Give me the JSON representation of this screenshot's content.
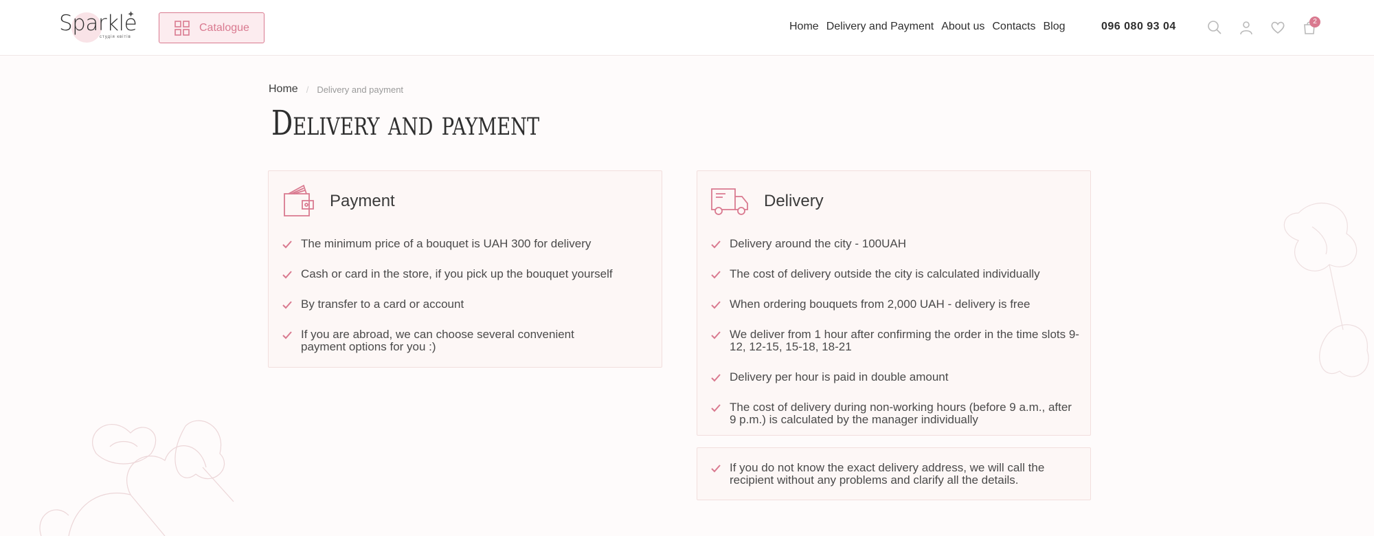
{
  "header": {
    "logo_text": "Sparkle",
    "logo_tagline": "студія квітів",
    "catalogue_label": "Catalogue",
    "nav": [
      "Home",
      "Delivery and Payment",
      "About us",
      "Contacts",
      "Blog"
    ],
    "phone": "096 080 93 04",
    "icons": [
      "search-icon",
      "user-icon",
      "heart-icon",
      "cart-icon"
    ],
    "cart_count": "2"
  },
  "breadcrumb": {
    "home": "Home",
    "separator": "/",
    "current": "Delivery and payment"
  },
  "page_title": "Delivery and payment",
  "payment": {
    "title": "Payment",
    "icon": "wallet-icon",
    "items": [
      "The minimum price of a bouquet is UAH 300 for delivery",
      "Cash or card in the store, if you pick up the bouquet yourself",
      "By transfer to a card or account",
      "If you are abroad, we can choose several convenient payment options for you :)"
    ]
  },
  "delivery": {
    "title": "Delivery",
    "icon": "truck-icon",
    "items": [
      "Delivery around the city - 100UAH",
      "The cost of delivery outside the city is calculated individually",
      "When ordering bouquets from 2,000 UAH - delivery is free",
      "We deliver from 1 hour after confirming the order in the time slots 9-12, 12-15, 15-18, 18-21",
      "Delivery per hour is paid in double amount",
      "The cost of delivery during non-working hours (before 9 a.m., after 9 p.m.) is calculated by the manager individually"
    ]
  },
  "note": {
    "text": "If you do not know the exact delivery address, we will call the recipient without any problems and clarify all the details."
  },
  "colors": {
    "accent": "#d9798f",
    "card_bg": "#fdf7f6",
    "card_border": "#f2dedd",
    "page_bg": "#fefbfb"
  }
}
